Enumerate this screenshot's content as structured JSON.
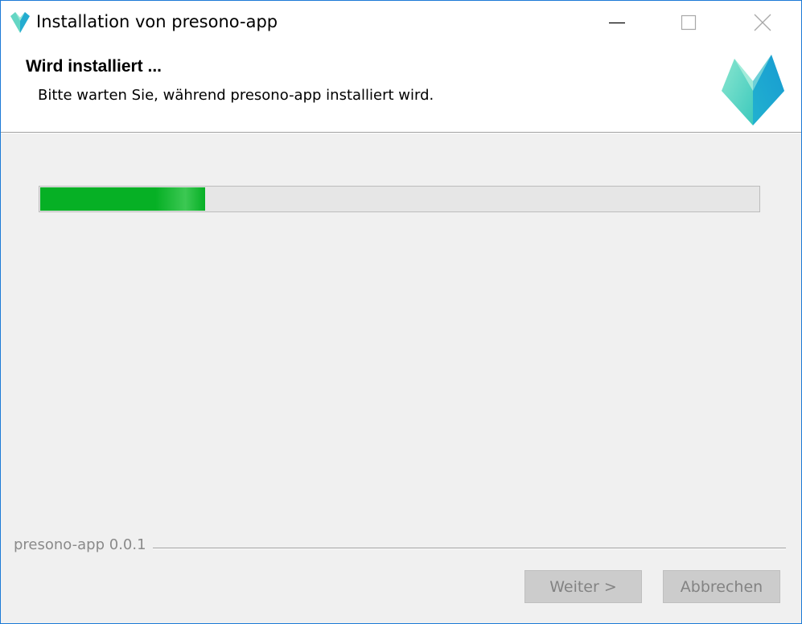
{
  "window": {
    "title": "Installation von presono-app",
    "icon": "presono-logo-icon",
    "controls": [
      "minimize-icon",
      "maximize-icon",
      "close-icon"
    ]
  },
  "header": {
    "title": "Wird installiert ...",
    "subtitle": "Bitte warten Sie, während presono-app installiert wird."
  },
  "progress": {
    "fraction": 0.23,
    "color": "#06b025"
  },
  "footer": {
    "brand": "presono-app 0.0.1",
    "next_label": "Weiter >",
    "cancel_label": "Abbrechen"
  },
  "colors": {
    "logo_light": "#7fe0c8",
    "logo_mid": "#3cc7c0",
    "logo_dark": "#1aa8cf"
  }
}
